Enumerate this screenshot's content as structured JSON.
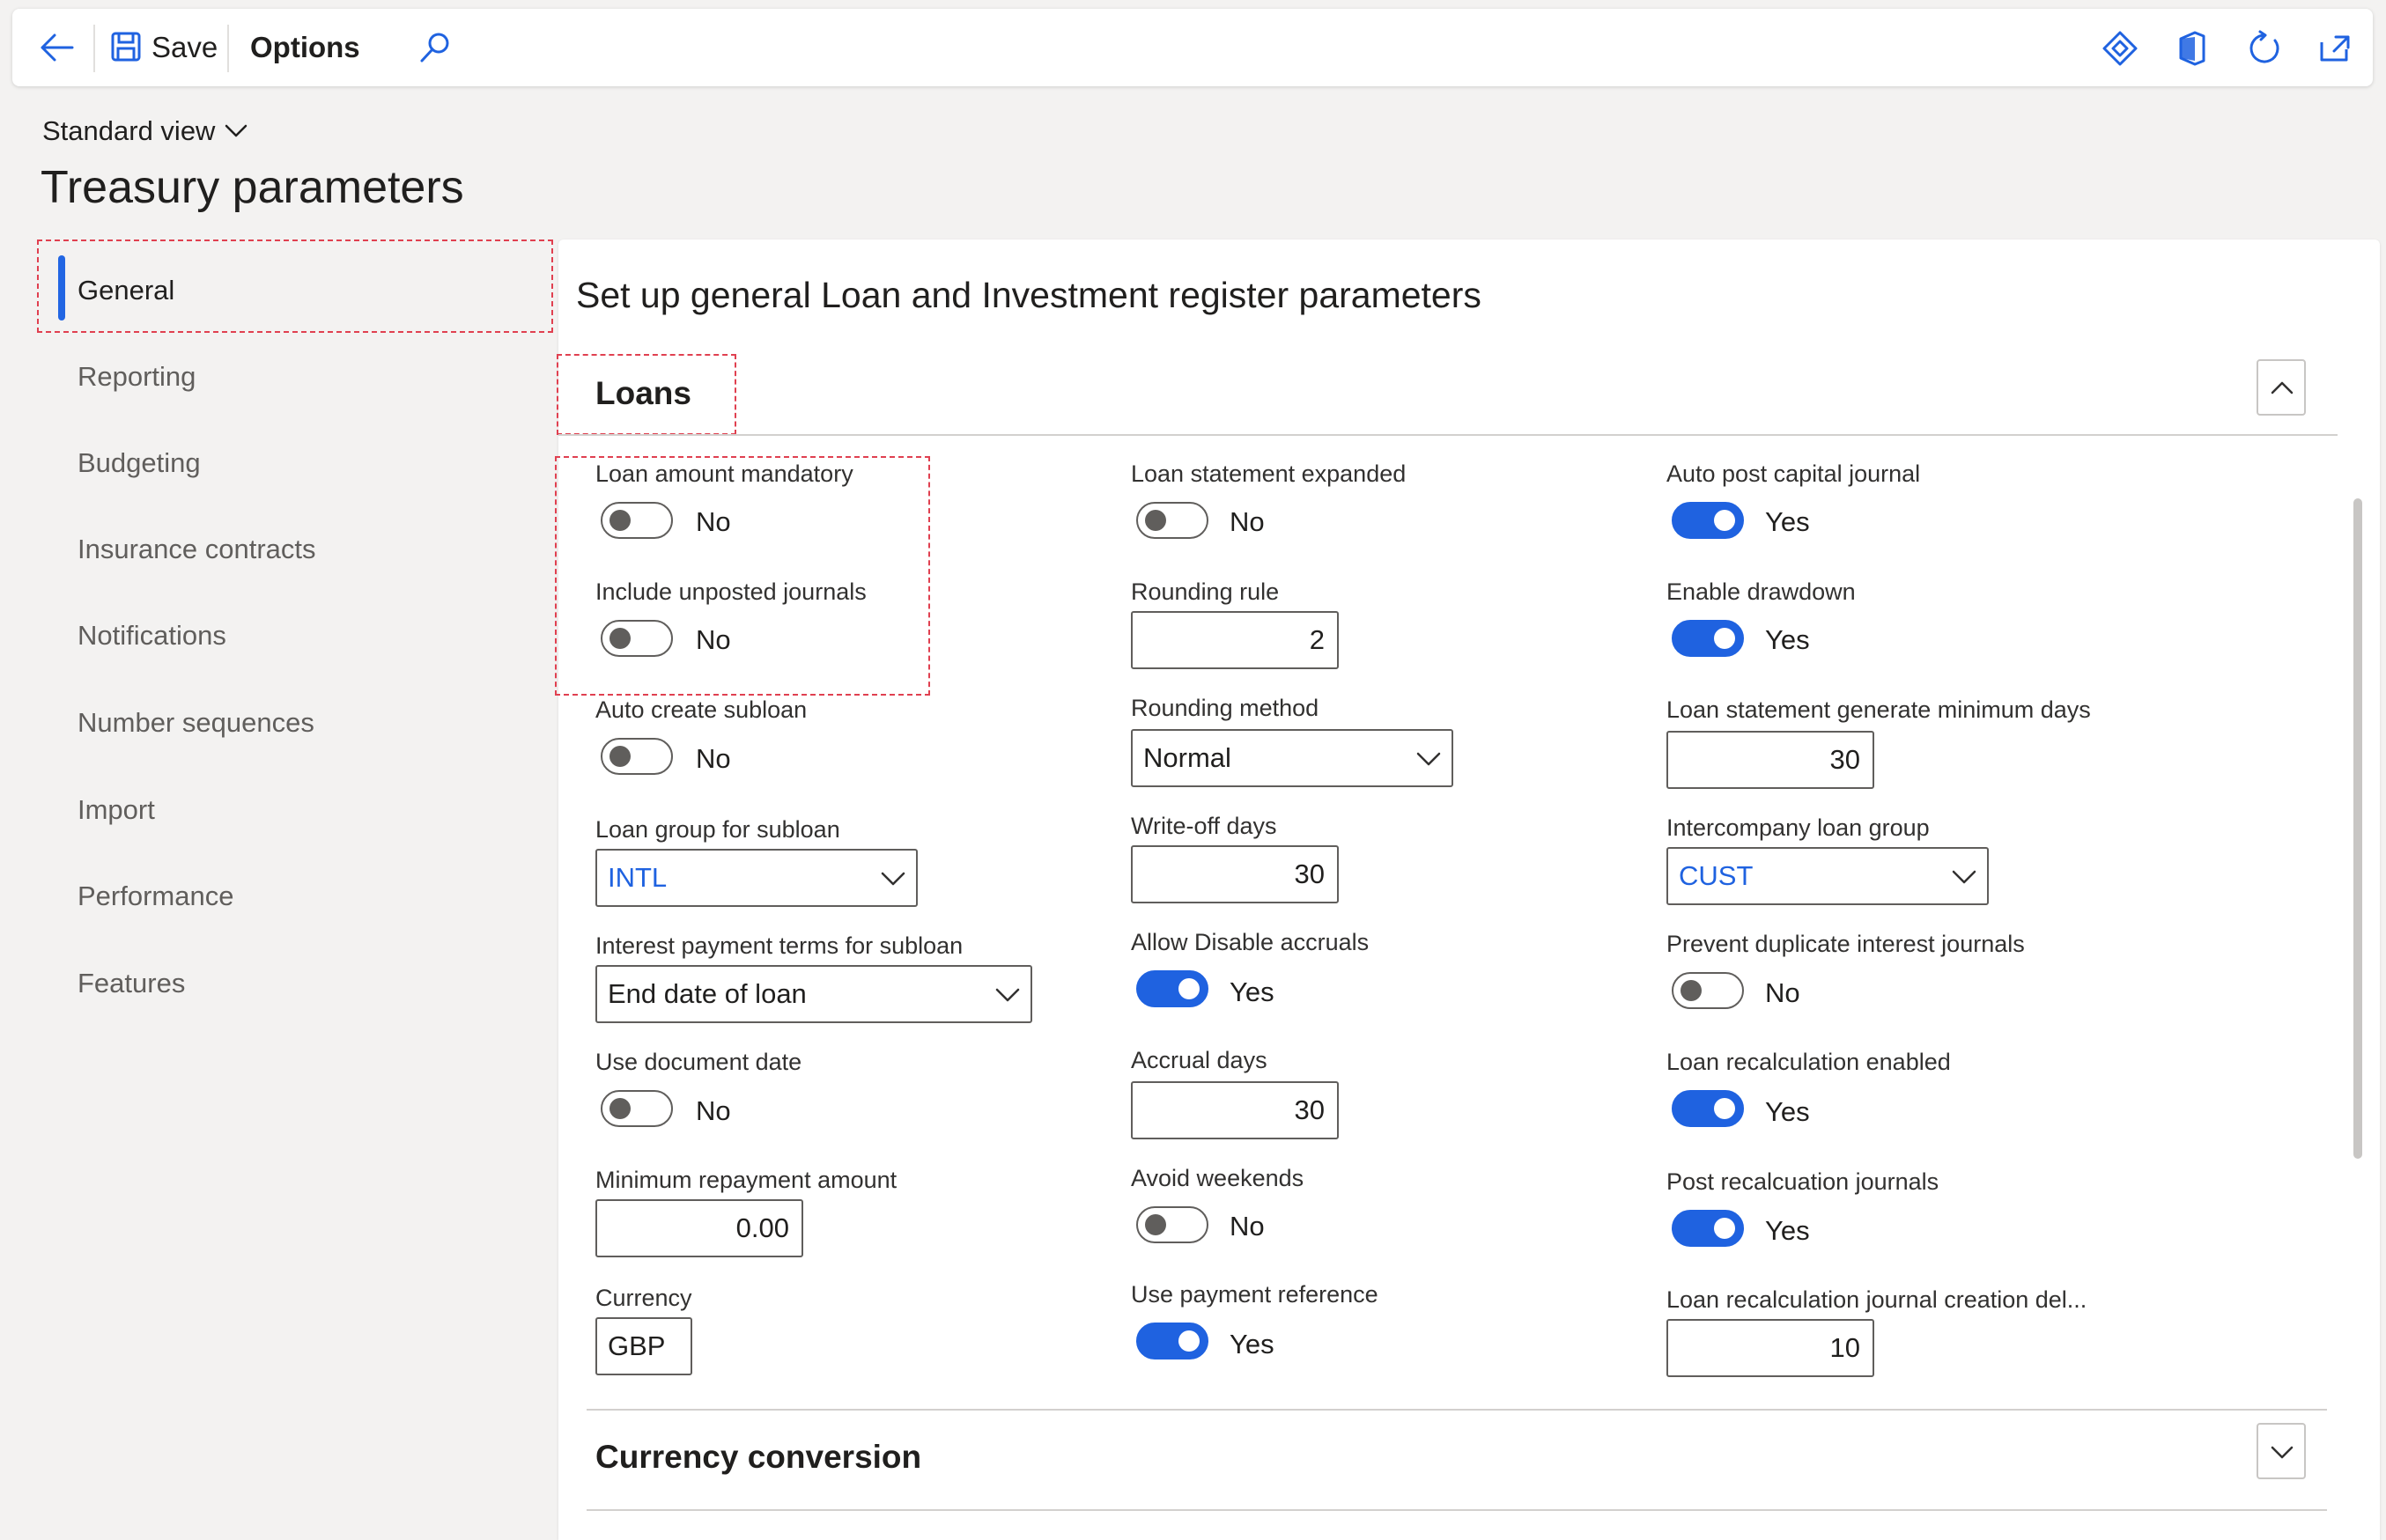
{
  "toolbar": {
    "save_label": "Save",
    "options_label": "Options",
    "icons": [
      "back-arrow-icon",
      "save-icon",
      "search-icon",
      "diamond-icon",
      "office-icon",
      "refresh-icon",
      "open-new-window-icon"
    ],
    "accent_color": "#1f62e0"
  },
  "header": {
    "view_label": "Standard view",
    "page_title": "Treasury parameters"
  },
  "sidebar": {
    "items": [
      {
        "label": "General",
        "active": true
      },
      {
        "label": "Reporting"
      },
      {
        "label": "Budgeting"
      },
      {
        "label": "Insurance contracts"
      },
      {
        "label": "Notifications"
      },
      {
        "label": "Number sequences"
      },
      {
        "label": "Import"
      },
      {
        "label": "Performance"
      },
      {
        "label": "Features"
      }
    ]
  },
  "main": {
    "section_title": "Set up general Loan and Investment register parameters",
    "loans_tab": {
      "title": "Loans",
      "col1": {
        "loan_amount_mandatory": {
          "label": "Loan amount mandatory",
          "value": "No"
        },
        "include_unposted_journals": {
          "label": "Include unposted journals",
          "value": "No"
        },
        "auto_create_subloan": {
          "label": "Auto create subloan",
          "value": "No"
        },
        "loan_group_for_subloan": {
          "label": "Loan group for subloan",
          "value": "INTL"
        },
        "interest_payment_terms": {
          "label": "Interest payment terms for subloan",
          "value": "End date of loan"
        },
        "use_document_date": {
          "label": "Use document date",
          "value": "No"
        },
        "minimum_repayment_amount": {
          "label": "Minimum repayment amount",
          "value": "0.00"
        },
        "currency": {
          "label": "Currency",
          "value": "GBP"
        }
      },
      "col2": {
        "loan_statement_expanded": {
          "label": "Loan statement expanded",
          "value": "No"
        },
        "rounding_rule": {
          "label": "Rounding rule",
          "value": "2"
        },
        "rounding_method": {
          "label": "Rounding method",
          "value": "Normal"
        },
        "write_off_days": {
          "label": "Write-off days",
          "value": "30"
        },
        "allow_disable_accruals": {
          "label": "Allow Disable accruals",
          "value": "Yes"
        },
        "accrual_days": {
          "label": "Accrual days",
          "value": "30"
        },
        "avoid_weekends": {
          "label": "Avoid weekends",
          "value": "No"
        },
        "use_payment_reference": {
          "label": "Use payment reference",
          "value": "Yes"
        }
      },
      "col3": {
        "auto_post_capital_journal": {
          "label": "Auto post capital journal",
          "value": "Yes"
        },
        "enable_drawdown": {
          "label": "Enable drawdown",
          "value": "Yes"
        },
        "statement_min_days": {
          "label": "Loan statement generate minimum days",
          "value": "30"
        },
        "intercompany_loan_group": {
          "label": "Intercompany loan group",
          "value": "CUST"
        },
        "prevent_duplicate_interest": {
          "label": "Prevent duplicate interest journals",
          "value": "No"
        },
        "loan_recalculation_enabled": {
          "label": "Loan recalculation enabled",
          "value": "Yes"
        },
        "post_recalculation_journals": {
          "label": "Post recalcuation journals",
          "value": "Yes"
        },
        "recalc_journal_creation_delay": {
          "label": "Loan recalculation journal creation del...",
          "value": "10"
        }
      }
    },
    "currency_tab": {
      "title": "Currency conversion"
    }
  }
}
